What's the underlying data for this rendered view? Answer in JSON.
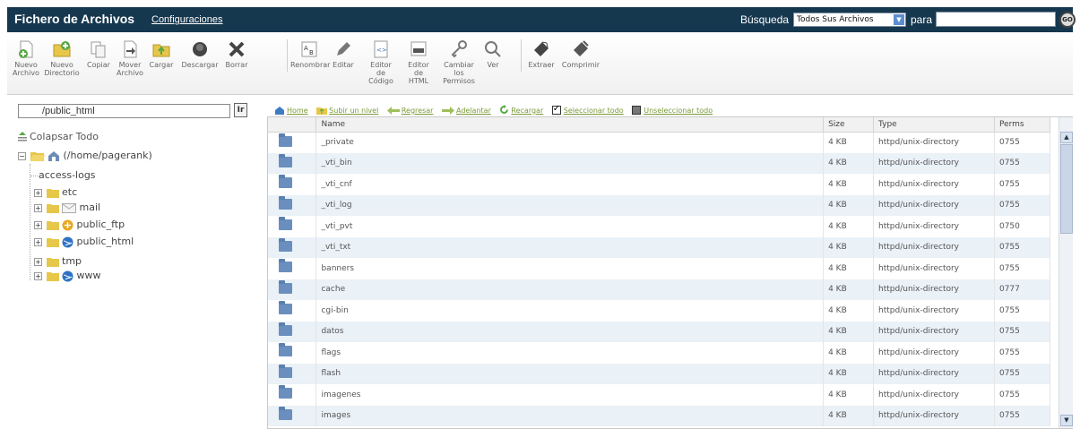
{
  "header": {
    "title": "Fichero de Archivos",
    "config_link": "Configuraciones",
    "search_label": "Búsqueda",
    "search_scope": "Todos Sus Archivos",
    "para_label": "para",
    "search_value": "",
    "go_label": "GO"
  },
  "toolbar": {
    "new_file": [
      "Nuevo",
      "Archivo"
    ],
    "new_dir": [
      "Nuevo",
      "Directorio"
    ],
    "copy": [
      "Copiar"
    ],
    "move": [
      "Mover",
      "Archivo"
    ],
    "upload": [
      "Cargar"
    ],
    "download": [
      "Descargar"
    ],
    "delete": [
      "Borrar"
    ],
    "rename": [
      "Renombrar"
    ],
    "edit": [
      "Editar"
    ],
    "code_editor": [
      "Editor",
      "de",
      "Código"
    ],
    "html_editor": [
      "Editor",
      "de",
      "HTML"
    ],
    "permissions": [
      "Cambiar",
      "los",
      "Permisos"
    ],
    "view": [
      "Ver"
    ],
    "extract": [
      "Extraer"
    ],
    "compress": [
      "Comprimir"
    ]
  },
  "left": {
    "path_value": "/public_html",
    "path_go": "Ir",
    "collapse_all": "Colapsar Todo",
    "tree": {
      "root": "(/home/pagerank)",
      "access_logs": "access-logs",
      "etc": "etc",
      "mail": "mail",
      "public_ftp": "public_ftp",
      "public_html": "public_html",
      "tmp": "tmp",
      "www": "www"
    }
  },
  "nav": {
    "home": "Home",
    "up": "Subir un nivel",
    "back": "Regresar",
    "forward": "Adelantar",
    "reload": "Recargar",
    "select_all": "Seleccionar todo",
    "unselect_all": "Unseleccionar todo"
  },
  "table": {
    "headers": {
      "name": "Name",
      "size": "Size",
      "type": "Type",
      "perms": "Perms"
    },
    "rows": [
      {
        "name": "_private",
        "size": "4 KB",
        "type": "httpd/unix-directory",
        "perms": "0755"
      },
      {
        "name": "_vti_bin",
        "size": "4 KB",
        "type": "httpd/unix-directory",
        "perms": "0755"
      },
      {
        "name": "_vti_cnf",
        "size": "4 KB",
        "type": "httpd/unix-directory",
        "perms": "0755"
      },
      {
        "name": "_vti_log",
        "size": "4 KB",
        "type": "httpd/unix-directory",
        "perms": "0755"
      },
      {
        "name": "_vti_pvt",
        "size": "4 KB",
        "type": "httpd/unix-directory",
        "perms": "0750"
      },
      {
        "name": "_vti_txt",
        "size": "4 KB",
        "type": "httpd/unix-directory",
        "perms": "0755"
      },
      {
        "name": "banners",
        "size": "4 KB",
        "type": "httpd/unix-directory",
        "perms": "0755"
      },
      {
        "name": "cache",
        "size": "4 KB",
        "type": "httpd/unix-directory",
        "perms": "0777"
      },
      {
        "name": "cgi-bin",
        "size": "4 KB",
        "type": "httpd/unix-directory",
        "perms": "0755"
      },
      {
        "name": "datos",
        "size": "4 KB",
        "type": "httpd/unix-directory",
        "perms": "0755"
      },
      {
        "name": "flags",
        "size": "4 KB",
        "type": "httpd/unix-directory",
        "perms": "0755"
      },
      {
        "name": "flash",
        "size": "4 KB",
        "type": "httpd/unix-directory",
        "perms": "0755"
      },
      {
        "name": "imagenes",
        "size": "4 KB",
        "type": "httpd/unix-directory",
        "perms": "0755"
      },
      {
        "name": "images",
        "size": "4 KB",
        "type": "httpd/unix-directory",
        "perms": "0755"
      }
    ]
  },
  "colors": {
    "header_bg": "#16384f",
    "row_alt": "#eaf1f7",
    "folder": "#6a8fbf",
    "nav_text": "#7a9a3a"
  }
}
